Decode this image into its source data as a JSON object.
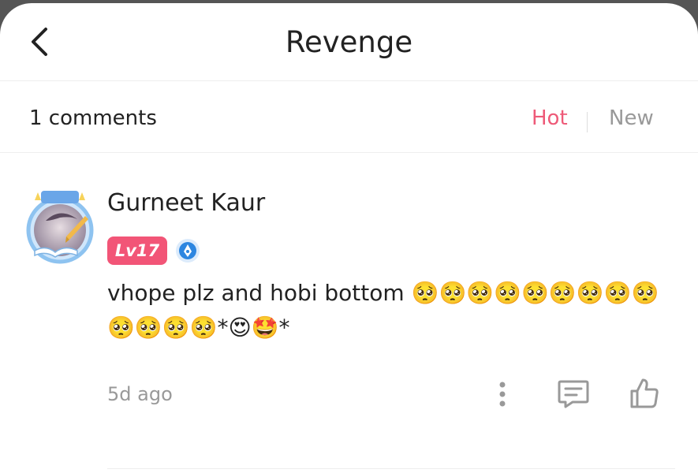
{
  "header": {
    "title": "Revenge",
    "back_icon": "chevron-left-icon"
  },
  "comments_bar": {
    "count_label": "1 comments",
    "sort_hot": "Hot",
    "sort_new": "New",
    "active_color": "#ee5a78",
    "inactive_color": "#999999"
  },
  "comment": {
    "avatar_frame_label": "WRITER",
    "username": "Gurneet Kaur",
    "level": "Lv17",
    "level_color": "#f25577",
    "verified_icon": "pen-badge-icon",
    "text": "vhope plz and hobi bottom 🥺🥺🥺🥺🥺🥺🥺🥺🥺🥺🥺🥺🥺*😍🤩*",
    "time": "5d ago",
    "actions": [
      "more-icon",
      "reply-icon",
      "like-icon"
    ]
  }
}
